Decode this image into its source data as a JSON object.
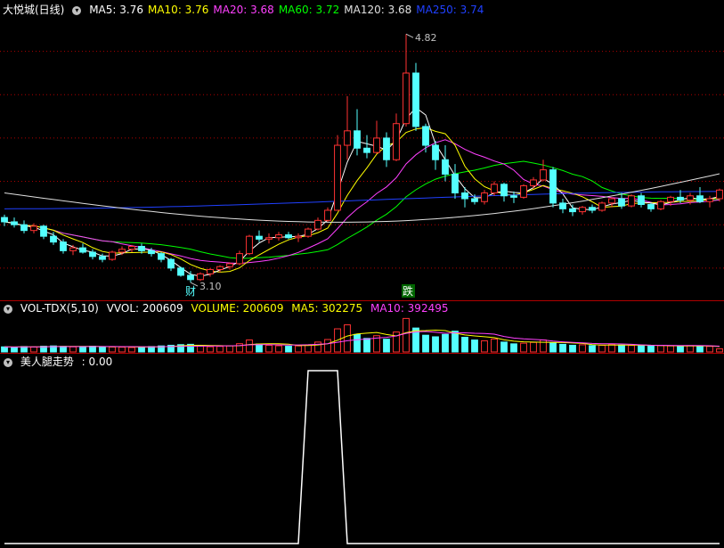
{
  "stock": {
    "title": "大悦城(日线)",
    "ma": [
      {
        "label": "MA5: 3.76",
        "color": "#ffffff"
      },
      {
        "label": "MA10: 3.76",
        "color": "#ffff00"
      },
      {
        "label": "MA20: 3.68",
        "color": "#ff40ff"
      },
      {
        "label": "MA60: 3.72",
        "color": "#00ff00"
      },
      {
        "label": "MA120: 3.68",
        "color": "#e0e0e0"
      },
      {
        "label": "MA250: 3.74",
        "color": "#2040ff"
      }
    ],
    "high_label": "4.82",
    "low_label": "3.10",
    "marker_cai": "财",
    "marker_die": "跌"
  },
  "volume": {
    "title": "VOL-TDX(5,10)",
    "vvol": "VVOL: 200609",
    "volume": "VOLUME: 200609",
    "ma5": "MA5: 302275",
    "ma10": "MA10: 392495"
  },
  "indicator": {
    "title": "美人腿走势",
    "value": ": 0.00"
  },
  "colors": {
    "up": "#ff3232",
    "down": "#54ffff",
    "grid": "#b00000",
    "axis": "#b00000"
  },
  "chart_data": [
    {
      "type": "candlestick",
      "title": "大悦城(日线)",
      "ohlc": [
        [
          3.55,
          3.57,
          3.49,
          3.52
        ],
        [
          3.52,
          3.55,
          3.48,
          3.5
        ],
        [
          3.5,
          3.53,
          3.44,
          3.46
        ],
        [
          3.46,
          3.51,
          3.44,
          3.49
        ],
        [
          3.49,
          3.5,
          3.4,
          3.42
        ],
        [
          3.42,
          3.45,
          3.36,
          3.38
        ],
        [
          3.38,
          3.4,
          3.3,
          3.32
        ],
        [
          3.32,
          3.36,
          3.29,
          3.34
        ],
        [
          3.34,
          3.37,
          3.3,
          3.31
        ],
        [
          3.31,
          3.33,
          3.26,
          3.28
        ],
        [
          3.28,
          3.3,
          3.24,
          3.26
        ],
        [
          3.26,
          3.32,
          3.25,
          3.31
        ],
        [
          3.31,
          3.35,
          3.29,
          3.33
        ],
        [
          3.33,
          3.36,
          3.31,
          3.35
        ],
        [
          3.35,
          3.37,
          3.3,
          3.32
        ],
        [
          3.32,
          3.34,
          3.28,
          3.3
        ],
        [
          3.3,
          3.31,
          3.24,
          3.26
        ],
        [
          3.26,
          3.27,
          3.18,
          3.2
        ],
        [
          3.2,
          3.21,
          3.14,
          3.15
        ],
        [
          3.15,
          3.18,
          3.1,
          3.12
        ],
        [
          3.12,
          3.17,
          3.11,
          3.16
        ],
        [
          3.16,
          3.2,
          3.14,
          3.19
        ],
        [
          3.19,
          3.22,
          3.17,
          3.21
        ],
        [
          3.21,
          3.24,
          3.19,
          3.23
        ],
        [
          3.23,
          3.32,
          3.22,
          3.3
        ],
        [
          3.3,
          3.43,
          3.29,
          3.42
        ],
        [
          3.42,
          3.46,
          3.38,
          3.4
        ],
        [
          3.4,
          3.44,
          3.37,
          3.41
        ],
        [
          3.41,
          3.45,
          3.39,
          3.43
        ],
        [
          3.43,
          3.45,
          3.4,
          3.41
        ],
        [
          3.41,
          3.44,
          3.38,
          3.42
        ],
        [
          3.42,
          3.48,
          3.41,
          3.47
        ],
        [
          3.47,
          3.55,
          3.46,
          3.53
        ],
        [
          3.53,
          3.62,
          3.52,
          3.6
        ],
        [
          3.6,
          4.12,
          3.6,
          4.05
        ],
        [
          4.05,
          4.39,
          3.95,
          4.15
        ],
        [
          4.15,
          4.3,
          3.98,
          4.03
        ],
        [
          4.03,
          4.12,
          3.96,
          4.0
        ],
        [
          4.0,
          4.22,
          3.99,
          4.1
        ],
        [
          4.1,
          4.14,
          3.9,
          3.95
        ],
        [
          3.95,
          4.27,
          3.94,
          4.2
        ],
        [
          4.2,
          4.82,
          4.18,
          4.55
        ],
        [
          4.55,
          4.62,
          4.15,
          4.18
        ],
        [
          4.18,
          4.2,
          4.0,
          4.05
        ],
        [
          4.05,
          4.08,
          3.88,
          3.95
        ],
        [
          3.95,
          4.05,
          3.8,
          3.85
        ],
        [
          3.85,
          3.92,
          3.68,
          3.72
        ],
        [
          3.72,
          3.76,
          3.62,
          3.68
        ],
        [
          3.68,
          3.71,
          3.64,
          3.66
        ],
        [
          3.66,
          3.74,
          3.64,
          3.72
        ],
        [
          3.72,
          3.8,
          3.7,
          3.78
        ],
        [
          3.78,
          3.79,
          3.66,
          3.7
        ],
        [
          3.7,
          3.73,
          3.65,
          3.69
        ],
        [
          3.69,
          3.78,
          3.68,
          3.77
        ],
        [
          3.77,
          3.83,
          3.75,
          3.81
        ],
        [
          3.81,
          3.95,
          3.8,
          3.88
        ],
        [
          3.88,
          3.9,
          3.62,
          3.65
        ],
        [
          3.65,
          3.68,
          3.58,
          3.61
        ],
        [
          3.61,
          3.64,
          3.56,
          3.59
        ],
        [
          3.59,
          3.63,
          3.57,
          3.62
        ],
        [
          3.62,
          3.64,
          3.58,
          3.6
        ],
        [
          3.6,
          3.66,
          3.59,
          3.65
        ],
        [
          3.65,
          3.69,
          3.62,
          3.68
        ],
        [
          3.68,
          3.72,
          3.61,
          3.63
        ],
        [
          3.63,
          3.71,
          3.62,
          3.7
        ],
        [
          3.7,
          3.72,
          3.62,
          3.64
        ],
        [
          3.64,
          3.65,
          3.59,
          3.61
        ],
        [
          3.61,
          3.67,
          3.6,
          3.66
        ],
        [
          3.66,
          3.7,
          3.63,
          3.69
        ],
        [
          3.69,
          3.74,
          3.65,
          3.67
        ],
        [
          3.67,
          3.72,
          3.64,
          3.7
        ],
        [
          3.7,
          3.76,
          3.65,
          3.66
        ],
        [
          3.66,
          3.7,
          3.62,
          3.68
        ],
        [
          3.68,
          3.75,
          3.66,
          3.74
        ]
      ],
      "moving_averages": {
        "MA5": 3.76,
        "MA10": 3.76,
        "MA20": 3.68,
        "MA60": 3.72,
        "MA120": 3.68,
        "MA250": 3.74
      },
      "annotations": [
        {
          "label": "4.82",
          "value": 4.82
        },
        {
          "label": "3.10",
          "value": 3.1
        }
      ],
      "ylim": [
        3.02,
        4.92
      ]
    },
    {
      "type": "bar",
      "title": "VOL-TDX(5,10)",
      "values": [
        3.2,
        3.0,
        3.4,
        3.1,
        3.6,
        3.8,
        3.5,
        3.2,
        3.4,
        3.6,
        3.3,
        3.1,
        3.0,
        2.8,
        3.2,
        3.4,
        3.8,
        4.2,
        4.6,
        4.8,
        3.6,
        3.3,
        3.5,
        3.9,
        5.2,
        7.5,
        5.0,
        4.2,
        3.9,
        3.6,
        3.8,
        4.5,
        6.2,
        7.8,
        14.5,
        17.0,
        11.0,
        8.5,
        10.2,
        8.0,
        12.5,
        21.0,
        15.0,
        10.5,
        9.5,
        11.0,
        13.0,
        9.2,
        7.5,
        7.0,
        8.1,
        6.2,
        5.1,
        5.5,
        6.0,
        7.5,
        5.8,
        4.8,
        4.2,
        4.5,
        4.0,
        4.2,
        4.8,
        4.3,
        4.1,
        3.9,
        3.7,
        4.0,
        3.8,
        3.6,
        4.0,
        3.9,
        3.5,
        2.0
      ],
      "series": [
        {
          "name": "MA5",
          "value": 302275
        },
        {
          "name": "MA10",
          "value": 392495
        }
      ],
      "last_volume": 200609,
      "ylim": [
        0,
        24
      ]
    },
    {
      "type": "line",
      "title": "美人腿走势",
      "values": [
        0,
        0,
        0,
        0,
        0,
        0,
        0,
        0,
        0,
        0,
        0,
        0,
        0,
        0,
        0,
        0,
        0,
        0,
        0,
        0,
        0,
        0,
        0,
        0,
        0,
        0,
        0,
        0,
        0,
        0,
        0,
        1,
        1,
        1,
        1,
        0,
        0,
        0,
        0,
        0,
        0,
        0,
        0,
        0,
        0,
        0,
        0,
        0,
        0,
        0,
        0,
        0,
        0,
        0,
        0,
        0,
        0,
        0,
        0,
        0,
        0,
        0,
        0,
        0,
        0,
        0,
        0,
        0,
        0,
        0,
        0,
        0,
        0,
        0
      ],
      "last_value": 0.0,
      "ylim": [
        0,
        1
      ]
    }
  ]
}
